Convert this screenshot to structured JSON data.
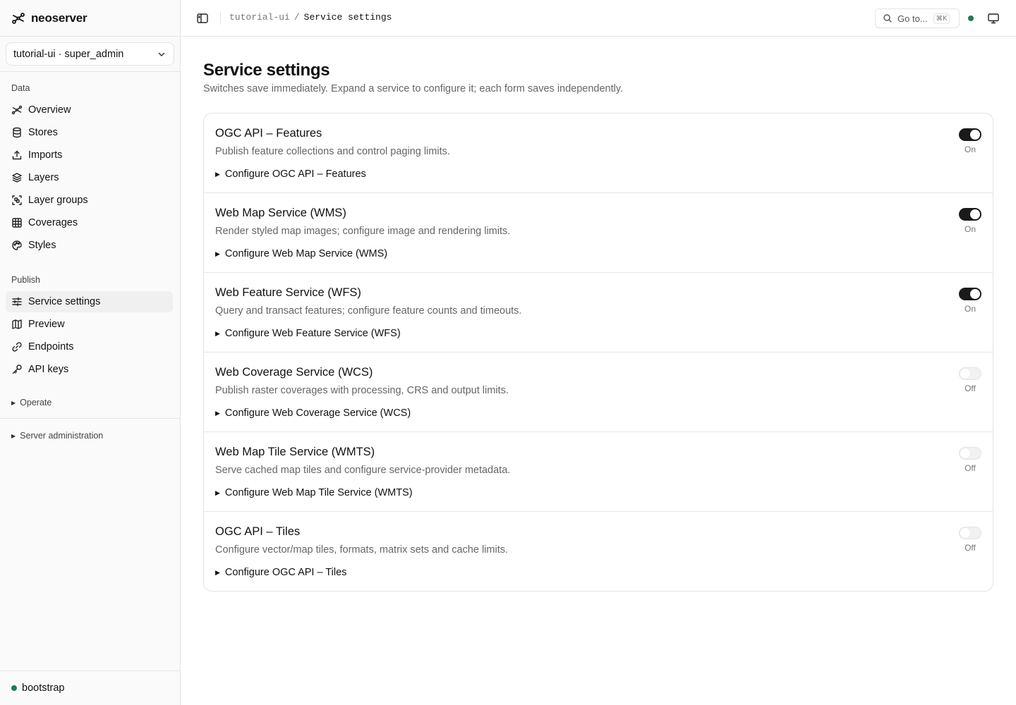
{
  "app": {
    "name": "neoserver",
    "tenant_selector": "tutorial-ui · super_admin",
    "footer_status": "bootstrap"
  },
  "sidebar": {
    "data_label": "Data",
    "data_items": [
      {
        "label": "Overview",
        "icon": "overview-icon"
      },
      {
        "label": "Stores",
        "icon": "database-icon"
      },
      {
        "label": "Imports",
        "icon": "upload-icon"
      },
      {
        "label": "Layers",
        "icon": "layers-icon"
      },
      {
        "label": "Layer groups",
        "icon": "group-icon"
      },
      {
        "label": "Coverages",
        "icon": "grid-icon"
      },
      {
        "label": "Styles",
        "icon": "palette-icon"
      }
    ],
    "publish_label": "Publish",
    "publish_items": [
      {
        "label": "Service settings",
        "icon": "sliders-icon",
        "active": true
      },
      {
        "label": "Preview",
        "icon": "map-icon"
      },
      {
        "label": "Endpoints",
        "icon": "link-icon"
      },
      {
        "label": "API keys",
        "icon": "key-icon"
      }
    ],
    "operate_label": "Operate",
    "server_admin_label": "Server administration"
  },
  "topbar": {
    "breadcrumb_root": "tutorial-ui",
    "breadcrumb_sep": "/",
    "breadcrumb_current": "Service settings",
    "goto_label": "Go to...",
    "goto_shortcut": "⌘K",
    "status_color": "#1f7a52"
  },
  "page": {
    "title": "Service settings",
    "subtitle": "Switches save immediately. Expand a service to configure it; each form saves independently."
  },
  "services": [
    {
      "name": "OGC API – Features",
      "description": "Publish feature collections and control paging limits.",
      "configure": "Configure OGC API – Features",
      "enabled": true,
      "state_label": "On"
    },
    {
      "name": "Web Map Service (WMS)",
      "description": "Render styled map images; configure image and rendering limits.",
      "configure": "Configure Web Map Service (WMS)",
      "enabled": true,
      "state_label": "On"
    },
    {
      "name": "Web Feature Service (WFS)",
      "description": "Query and transact features; configure feature counts and timeouts.",
      "configure": "Configure Web Feature Service (WFS)",
      "enabled": true,
      "state_label": "On"
    },
    {
      "name": "Web Coverage Service (WCS)",
      "description": "Publish raster coverages with processing, CRS and output limits.",
      "configure": "Configure Web Coverage Service (WCS)",
      "enabled": false,
      "state_label": "Off"
    },
    {
      "name": "Web Map Tile Service (WMTS)",
      "description": "Serve cached map tiles and configure service-provider metadata.",
      "configure": "Configure Web Map Tile Service (WMTS)",
      "enabled": false,
      "state_label": "Off"
    },
    {
      "name": "OGC API – Tiles",
      "description": "Configure vector/map tiles, formats, matrix sets and cache limits.",
      "configure": "Configure OGC API – Tiles",
      "enabled": false,
      "state_label": "Off"
    }
  ]
}
